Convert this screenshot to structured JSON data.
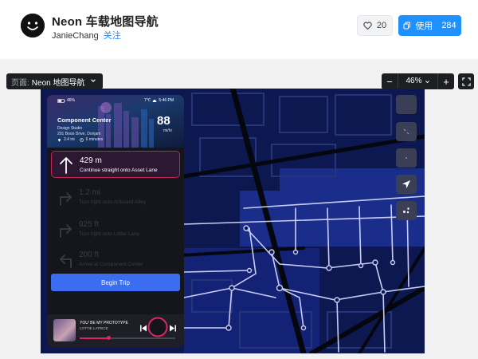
{
  "header": {
    "title": "Neon 车载地图导航",
    "author": "JanieChang",
    "follow_label": "关注",
    "like_count": "20",
    "use_label": "使用",
    "use_count": "284"
  },
  "toolbar": {
    "page_label": "页面:",
    "page_name": "Neon 地图导航",
    "zoom_minus": "−",
    "zoom_value": "46%",
    "zoom_plus": "+"
  },
  "panel": {
    "battery": "46%",
    "temperature": "7℃",
    "time": "5:46 PM",
    "place_title": "Component Center",
    "place_lines": [
      "Design Studio",
      "201 Booo Drive, Donjam"
    ],
    "trip_distance": "3.4 mi",
    "trip_time": "6 minutes",
    "speed": "88",
    "speed_unit": "mi/hr",
    "steps": [
      {
        "distance": "429 m",
        "instruction": "Continue straight onto Asset Lane",
        "icon": "arrow-up-icon"
      },
      {
        "distance": "1.2 mi",
        "instruction": "Turn right onto Artboard Alley",
        "icon": "turn-right-icon"
      },
      {
        "distance": "925 ft",
        "instruction": "Turn right onto Lottie Lane",
        "icon": "turn-right-icon"
      },
      {
        "distance": "200 ft",
        "instruction": "Arrive at Component Center",
        "icon": "turn-left-icon"
      }
    ],
    "begin_label": "Begin Trip",
    "player": {
      "song": "YOU'  BE MY PROTOTYPE",
      "artist": "LOTTIE LATRICE",
      "progress": 0.3
    }
  },
  "colors": {
    "accent_blue": "#1e90ff",
    "map_bg": "#0d1850",
    "active_step_border": "#c2245a",
    "begin_button": "#3a6df0",
    "progress": "#d9266a"
  }
}
